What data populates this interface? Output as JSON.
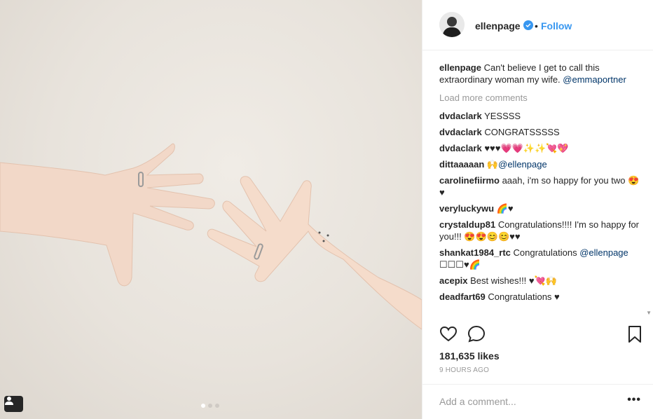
{
  "post": {
    "username": "ellenpage",
    "follow_label": "Follow",
    "bullet": "•",
    "caption_user": "ellenpage",
    "caption_text": " Can't believe I get to call this extraordinary woman my wife. ",
    "caption_mention": "@emmaportner",
    "load_more": "Load more comments",
    "likes": "181,635 likes",
    "time": "9 HOURS AGO",
    "add_comment_placeholder": "Add a comment...",
    "more_label": "•••"
  },
  "comments": [
    {
      "user": "dvdaclark",
      "text": " YESSSS",
      "mention": ""
    },
    {
      "user": "dvdaclark",
      "text": " CONGRATSSSSS",
      "mention": ""
    },
    {
      "user": "dvdaclark",
      "text": " ♥♥♥💗💗✨✨💘💖",
      "mention": ""
    },
    {
      "user": "dittaaaaan",
      "text": " 🙌",
      "mention": "@ellenpage"
    },
    {
      "user": "carolinefiirmo",
      "text": " aaah, i'm so happy for you two 😍♥",
      "mention": ""
    },
    {
      "user": "veryluckywu",
      "text": " 🌈♥",
      "mention": ""
    },
    {
      "user": "crystaldup81",
      "text": " Congratulations!!!! I'm so happy for you!!! 😍😍😊😊♥♥",
      "mention": ""
    },
    {
      "user": "shankat1984_rtc",
      "text": " Congratulations ",
      "mention": "@ellenpage",
      "suffix": " ☐☐☐♥🌈"
    },
    {
      "user": "acepix",
      "text": " Best wishes!!! ♥💘🙌",
      "mention": ""
    },
    {
      "user": "deadfart69",
      "text": " Congratulations ♥",
      "mention": ""
    }
  ],
  "colors": {
    "accent": "#3897f0",
    "mention": "#003569",
    "muted": "#999999",
    "text": "#262626"
  },
  "icons": [
    "heart-icon",
    "comment-icon",
    "bookmark-icon",
    "verified-icon",
    "user-tag-icon"
  ],
  "carousel": {
    "count": 3,
    "active": 0
  }
}
